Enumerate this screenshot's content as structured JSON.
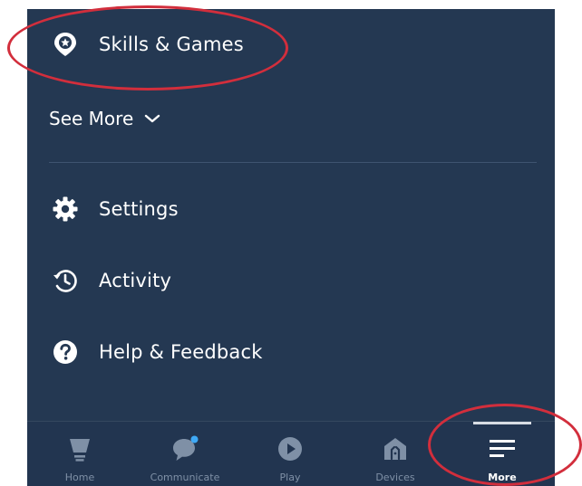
{
  "menu": {
    "skills_games": {
      "label": "Skills & Games",
      "icon": "skills-pin-star-icon"
    },
    "see_more": {
      "label": "See More",
      "icon": "chevron-down-icon"
    },
    "settings": {
      "label": "Settings",
      "icon": "gear-icon"
    },
    "activity": {
      "label": "Activity",
      "icon": "history-clock-icon"
    },
    "help": {
      "label": "Help & Feedback",
      "icon": "question-circle-icon"
    }
  },
  "bottom_nav": {
    "items": [
      {
        "label": "Home",
        "icon": "home-icon",
        "active": false
      },
      {
        "label": "Communicate",
        "icon": "speech-bubble-icon",
        "active": false
      },
      {
        "label": "Play",
        "icon": "play-circle-icon",
        "active": false
      },
      {
        "label": "Devices",
        "icon": "devices-house-icon",
        "active": false
      },
      {
        "label": "More",
        "icon": "hamburger-menu-icon",
        "active": true
      }
    ]
  },
  "colors": {
    "background": "#243852",
    "nav_background": "#223550",
    "text": "#ffffff",
    "inactive_nav": "#7f90a6",
    "highlight": "#d22e3c",
    "notification_dot": "#3fa9f5"
  }
}
